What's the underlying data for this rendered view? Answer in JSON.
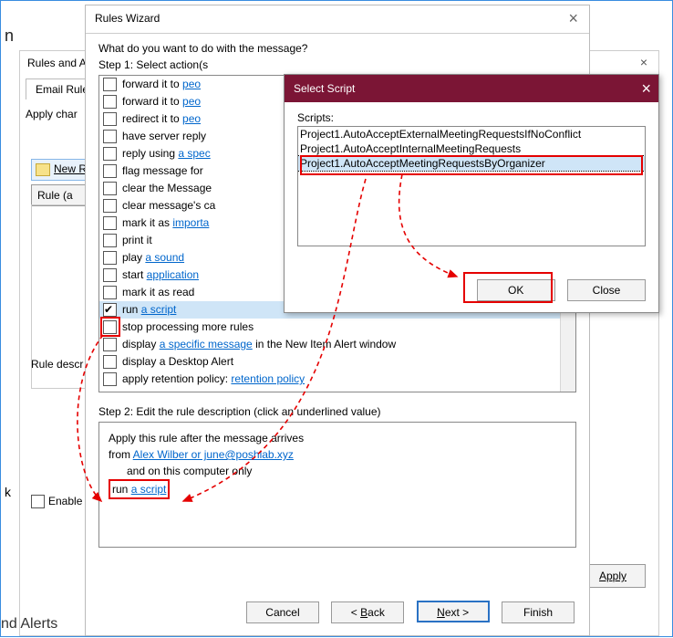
{
  "back": {
    "title": "Rules and Al",
    "tab": "Email Rules",
    "apply_label": "Apply char",
    "new_rule": "New R",
    "grid_header": "Rule (a",
    "rule_desc": "Rule descr",
    "enable": "Enable",
    "apply_btn": "Apply",
    "nd_alerts": "nd Alerts",
    "left_n": "n",
    "left_k": "k"
  },
  "wizard": {
    "title": "Rules Wizard",
    "question": "What do you want to do with the message?",
    "step1": "Step 1: Select action(s",
    "step2": "Step 2: Edit the rule description (click an underlined value)",
    "buttons": {
      "cancel": "Cancel",
      "back": "< ",
      "back_u": "B",
      "back_rest": "ack",
      "next_u": "N",
      "next_rest": "ext >",
      "finish": "Finish"
    }
  },
  "actions": [
    {
      "pre": "forward it to ",
      "link": "peo",
      "checked": false
    },
    {
      "pre": "forward it to ",
      "link": "peo",
      "checked": false
    },
    {
      "pre": "redirect it to ",
      "link": "peo",
      "checked": false
    },
    {
      "pre": "have server reply",
      "link": "",
      "checked": false
    },
    {
      "pre": "reply using ",
      "link": "a spec",
      "checked": false
    },
    {
      "pre": "flag message for ",
      "link": "",
      "checked": false
    },
    {
      "pre": "clear the Message",
      "link": "",
      "checked": false
    },
    {
      "pre": "clear message's ca",
      "link": "",
      "checked": false
    },
    {
      "pre": "mark it as ",
      "link": "importa",
      "checked": false
    },
    {
      "pre": "print it",
      "link": "",
      "checked": false
    },
    {
      "pre": "play ",
      "link": "a sound",
      "checked": false
    },
    {
      "pre": "start ",
      "link": "application",
      "checked": false
    },
    {
      "pre": "mark it as read",
      "link": "",
      "checked": false
    },
    {
      "pre": "run ",
      "link": "a script",
      "checked": true,
      "selected": true
    },
    {
      "pre": "stop processing more rules",
      "link": "",
      "checked": false
    },
    {
      "pre": "display ",
      "link": "a specific message",
      "post": " in the New Item Alert window",
      "checked": false
    },
    {
      "pre": "display a Desktop Alert",
      "link": "",
      "checked": false
    },
    {
      "pre": "apply retention policy: ",
      "link": "retention policy",
      "checked": false
    }
  ],
  "desc": {
    "l1": "Apply this rule after the message arrives",
    "l2_pre": "from ",
    "l2_link": "Alex Wilber or june@poshlab.xyz",
    "l3": "and on this computer only",
    "l4_pre": "run ",
    "l4_link": "a script"
  },
  "select_script": {
    "title": "Select Script",
    "label": "Scripts:",
    "items": [
      "Project1.AutoAcceptExternalMeetingRequestsIfNoConflict",
      "Project1.AutoAcceptInternalMeetingRequests",
      "Project1.AutoAcceptMeetingRequestsByOrganizer"
    ],
    "ok": "OK",
    "close": "Close"
  }
}
